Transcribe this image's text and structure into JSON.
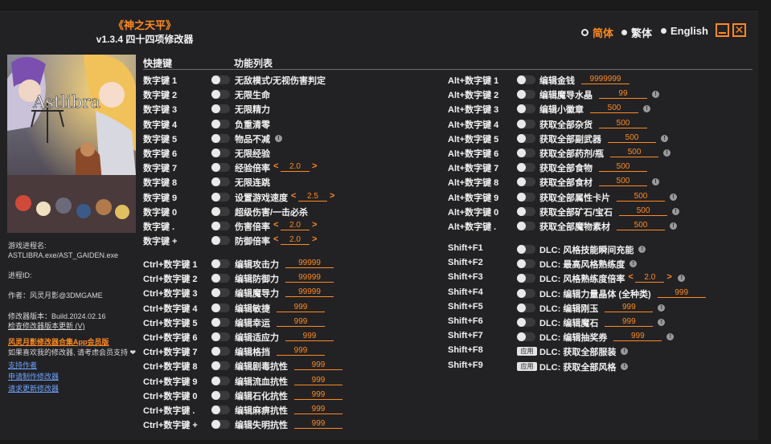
{
  "header": {
    "game_title": "《神之天平》",
    "version_title": "v1.3.4 四十四项修改器"
  },
  "languages": [
    {
      "label": "简体",
      "selected": true
    },
    {
      "label": "繁体",
      "selected": false
    },
    {
      "label": "English",
      "selected": false
    }
  ],
  "sidebar": {
    "process_name_label": "游戏进程名:",
    "process_name_value": "ASTLIBRA.exe/AST_GAIDEN.exe",
    "process_id_label": "进程ID:",
    "author": "作者：风灵月影@3DMGAME",
    "build": "修改器版本：Build.2024.02.16",
    "check_update": "检查修改器版本更新 (V)",
    "promo": "风灵月影修改器合集App会员版",
    "support_text": "如果喜欢我的修改器, 请考虑会员支持 ❤",
    "links": [
      "支持作者",
      "申请制作修改器",
      "请求更新修改器"
    ]
  },
  "columns": {
    "hotkey": "快捷键",
    "function_list": "功能列表"
  },
  "left_col": [
    {
      "key": "数字键 1",
      "fn": "无敌模式/无视伤害判定"
    },
    {
      "key": "数字键 2",
      "fn": "无限生命"
    },
    {
      "key": "数字键 3",
      "fn": "无限精力"
    },
    {
      "key": "数字键 4",
      "fn": "负重清零"
    },
    {
      "key": "数字键 5",
      "fn": "物品不减",
      "info": true
    },
    {
      "key": "数字键 6",
      "fn": "无限经验"
    },
    {
      "key": "数字键 7",
      "fn": "经验倍率",
      "stepper": "2.0"
    },
    {
      "key": "数字键 8",
      "fn": "无限连跳"
    },
    {
      "key": "数字键 9",
      "fn": "设置游戏速度",
      "stepper": "2.5"
    },
    {
      "key": "数字键 0",
      "fn": "超级伤害/一击必杀"
    },
    {
      "key": "数字键 .",
      "fn": "伤害倍率",
      "stepper": "2.0"
    },
    {
      "key": "数字键 +",
      "fn": "防御倍率",
      "stepper": "2.0"
    }
  ],
  "ctrl_col": [
    {
      "key": "Ctrl+数字键 1",
      "fn": "编辑攻击力",
      "value": "99999"
    },
    {
      "key": "Ctrl+数字键 2",
      "fn": "编辑防御力",
      "value": "99999"
    },
    {
      "key": "Ctrl+数字键 3",
      "fn": "编辑魔导力",
      "value": "99999"
    },
    {
      "key": "Ctrl+数字键 4",
      "fn": "编辑敏捷",
      "value": "999"
    },
    {
      "key": "Ctrl+数字键 5",
      "fn": "编辑幸运",
      "value": "999"
    },
    {
      "key": "Ctrl+数字键 6",
      "fn": "编辑适应力",
      "value": "999"
    },
    {
      "key": "Ctrl+数字键 7",
      "fn": "编辑格挡",
      "value": "999"
    },
    {
      "key": "Ctrl+数字键 8",
      "fn": "编辑剧毒抗性",
      "value": "999"
    },
    {
      "key": "Ctrl+数字键 9",
      "fn": "编辑流血抗性",
      "value": "999"
    },
    {
      "key": "Ctrl+数字键 0",
      "fn": "编辑石化抗性",
      "value": "999"
    },
    {
      "key": "Ctrl+数字键 .",
      "fn": "编辑麻痹抗性",
      "value": "999"
    },
    {
      "key": "Ctrl+数字键 +",
      "fn": "编辑失明抗性",
      "value": "999"
    }
  ],
  "alt_col": [
    {
      "key": "Alt+数字键 1",
      "fn": "编辑金钱",
      "value": "9999999"
    },
    {
      "key": "Alt+数字键 2",
      "fn": "编辑魔导水晶",
      "value": "99",
      "info": true
    },
    {
      "key": "Alt+数字键 3",
      "fn": "编辑小徽章",
      "value": "500",
      "info": true
    },
    {
      "key": "Alt+数字键 4",
      "fn": "获取全部杂货",
      "value": "500"
    },
    {
      "key": "Alt+数字键 5",
      "fn": "获取全部副武器",
      "value": "500",
      "info": true
    },
    {
      "key": "Alt+数字键 6",
      "fn": "获取全部药剂/瓶",
      "value": "500",
      "info": true
    },
    {
      "key": "Alt+数字键 7",
      "fn": "获取全部食物",
      "value": "500"
    },
    {
      "key": "Alt+数字键 8",
      "fn": "获取全部食材",
      "value": "500",
      "info": true
    },
    {
      "key": "Alt+数字键 9",
      "fn": "获取全部属性卡片",
      "value": "500",
      "info": true
    },
    {
      "key": "Alt+数字键 0",
      "fn": "获取全部矿石/宝石",
      "value": "500",
      "info": true
    },
    {
      "key": "Alt+数字键 .",
      "fn": "获取全部魔物素材",
      "value": "500",
      "info": true
    }
  ],
  "shift_col": [
    {
      "key": "Shift+F1",
      "fn": "DLC: 风格技能瞬间充能",
      "info": true
    },
    {
      "key": "Shift+F2",
      "fn": "DLC: 最高风格熟练度",
      "info": true
    },
    {
      "key": "Shift+F3",
      "fn": "DLC: 风格熟练度倍率",
      "stepper": "2.0",
      "info": true
    },
    {
      "key": "Shift+F4",
      "fn": "DLC: 编辑力量晶体 (全种类)",
      "value": "999"
    },
    {
      "key": "Shift+F5",
      "fn": "DLC: 编辑刚玉",
      "value": "999",
      "info": true
    },
    {
      "key": "Shift+F6",
      "fn": "DLC: 编辑魔石",
      "value": "999",
      "info": true
    },
    {
      "key": "Shift+F7",
      "fn": "DLC: 编辑抽奖券",
      "value": "999",
      "info": true
    },
    {
      "key": "Shift+F8",
      "fn": "DLC: 获取全部服装",
      "apply": "应用",
      "info": true
    },
    {
      "key": "Shift+F9",
      "fn": "DLC: 获取全部风格",
      "apply": "应用",
      "info": true
    }
  ],
  "cover": {
    "logo_text": "Astlibra"
  },
  "colors": {
    "accent": "#ff8a1f",
    "bg": "#222225"
  }
}
